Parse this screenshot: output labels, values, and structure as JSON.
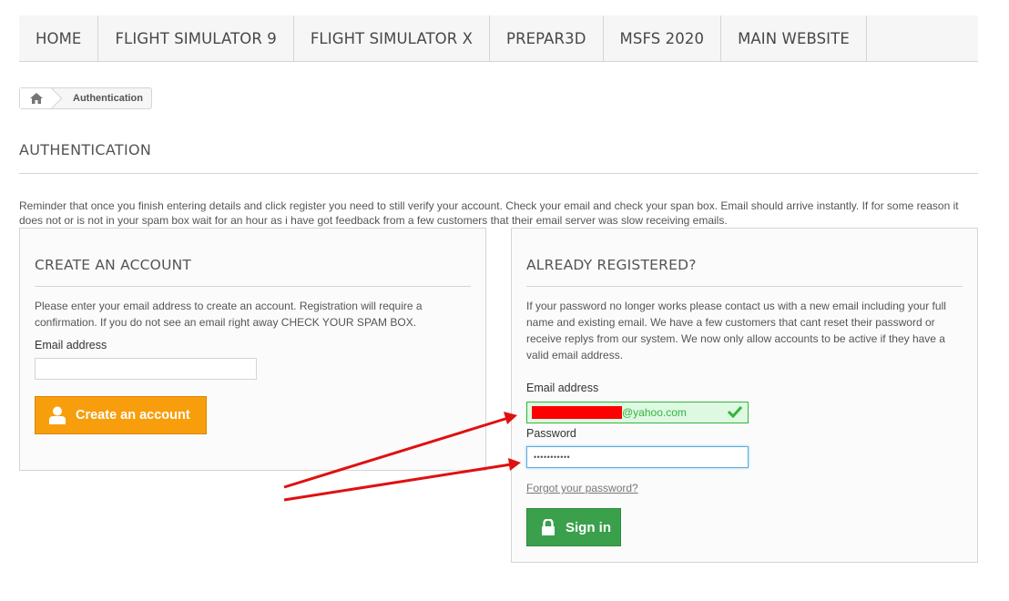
{
  "nav": {
    "items": [
      "HOME",
      "FLIGHT SIMULATOR 9",
      "FLIGHT SIMULATOR X",
      "PREPAR3D",
      "MSFS 2020",
      "MAIN WEBSITE"
    ]
  },
  "breadcrumb": {
    "home_icon": "home-icon",
    "current": "Authentication"
  },
  "page": {
    "heading": "AUTHENTICATION",
    "reminder": "Reminder that once you finish entering details and click register you need to still verify your account. Check your email and check your span box. Email should arrive instantly. If for some reason it does not or is not in your spam box wait for an hour as i have got feedback from a few customers that their email server was slow receiving emails."
  },
  "create": {
    "title": "CREATE AN ACCOUNT",
    "text": "Please enter your email address to create an account. Registration will require a confirmation. If you do not see an email right away CHECK YOUR SPAM BOX.",
    "email_label": "Email address",
    "email_value": "",
    "button_label": "Create an account",
    "button_icon": "user-icon"
  },
  "login": {
    "title": "ALREADY REGISTERED?",
    "text": "If your password no longer works please contact us with a new email including your full name and existing email. We have a few customers that cant reset their password or receive replys from our system. We now only allow accounts to be active if they have a valid email address.",
    "email_label": "Email address",
    "email_suffix": "@yahoo.com",
    "email_valid_icon": "checkmark-icon",
    "password_label": "Password",
    "password_value": "•••••••••••",
    "forgot_label": "Forgot your password?",
    "button_label": "Sign in",
    "button_icon": "lock-icon"
  },
  "colors": {
    "orange_button": "#f89e0c",
    "green_button": "#3aa04c",
    "valid_green": "#35b33f",
    "arrow_red": "#e01010"
  }
}
